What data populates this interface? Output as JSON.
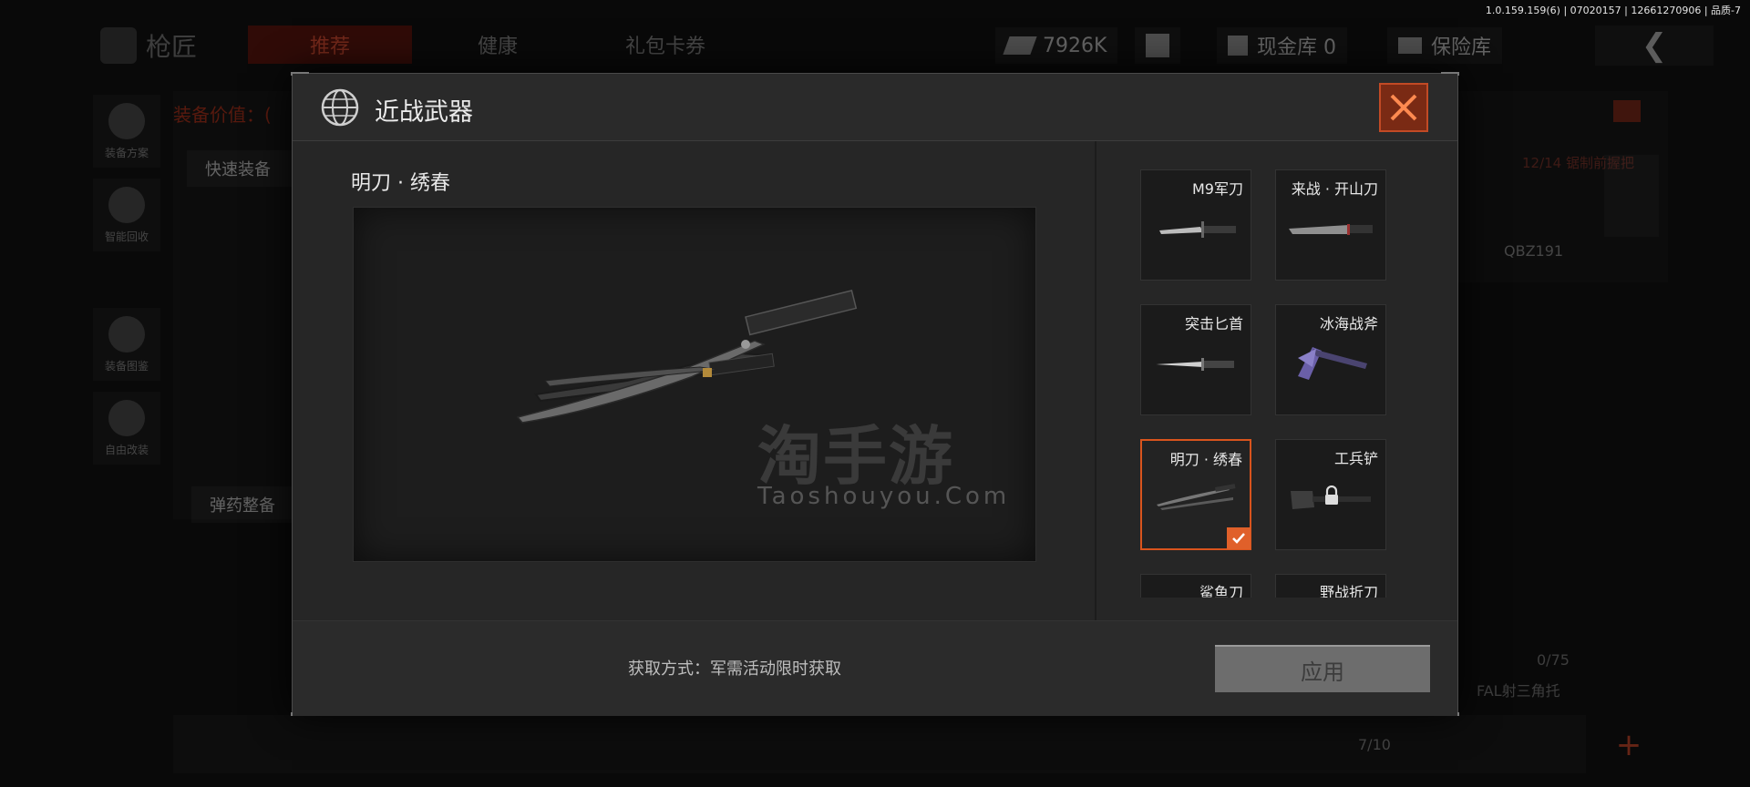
{
  "version_info": "1.0.159.159(6) | 07020157 | 12661270906 | 品质-7",
  "background": {
    "title": "枪匠",
    "tabs": [
      "推荐",
      "健康",
      "礼包卡券"
    ],
    "currency": "7926K",
    "vault": "现金库 0",
    "safe": "保险库",
    "side_buttons": [
      "装备方案",
      "智能回收",
      "装备图鉴",
      "自由改装"
    ],
    "loadout_price_label": "装备价值：(",
    "quick_equip": "快速装备",
    "ammo_label": "弹药整备",
    "right_label_top": "12/14  锯制前握把",
    "right_label_gun": "QBZ191",
    "right_ammo": "0/75",
    "right_mag": "FAL射三角托",
    "count": "7/10"
  },
  "modal": {
    "title": "近战武器",
    "selected_weapon_name": "明刀 · 绣春",
    "watermark_text": "淘手游",
    "watermark_sub": "Taoshouyou.Com",
    "weapons": [
      {
        "name": "M9军刀",
        "selected": false,
        "locked": false,
        "icon": "knife-icon"
      },
      {
        "name": "来战 · 开山刀",
        "selected": false,
        "locked": false,
        "icon": "machete-icon"
      },
      {
        "name": "突击匕首",
        "selected": false,
        "locked": false,
        "icon": "dagger-icon"
      },
      {
        "name": "冰海战斧",
        "selected": false,
        "locked": false,
        "icon": "axe-icon"
      },
      {
        "name": "明刀 · 绣春",
        "selected": true,
        "locked": false,
        "icon": "twin-sword-icon"
      },
      {
        "name": "工兵铲",
        "selected": false,
        "locked": true,
        "icon": "shovel-icon"
      },
      {
        "name": "鲨鱼刀",
        "selected": false,
        "locked": false,
        "icon": "knife-icon"
      },
      {
        "name": "野战折刀",
        "selected": false,
        "locked": false,
        "icon": "knife-icon"
      }
    ],
    "acquire_text": "获取方式：军需活动限时获取",
    "apply_label": "应用",
    "accent_color": "#d9541d"
  }
}
